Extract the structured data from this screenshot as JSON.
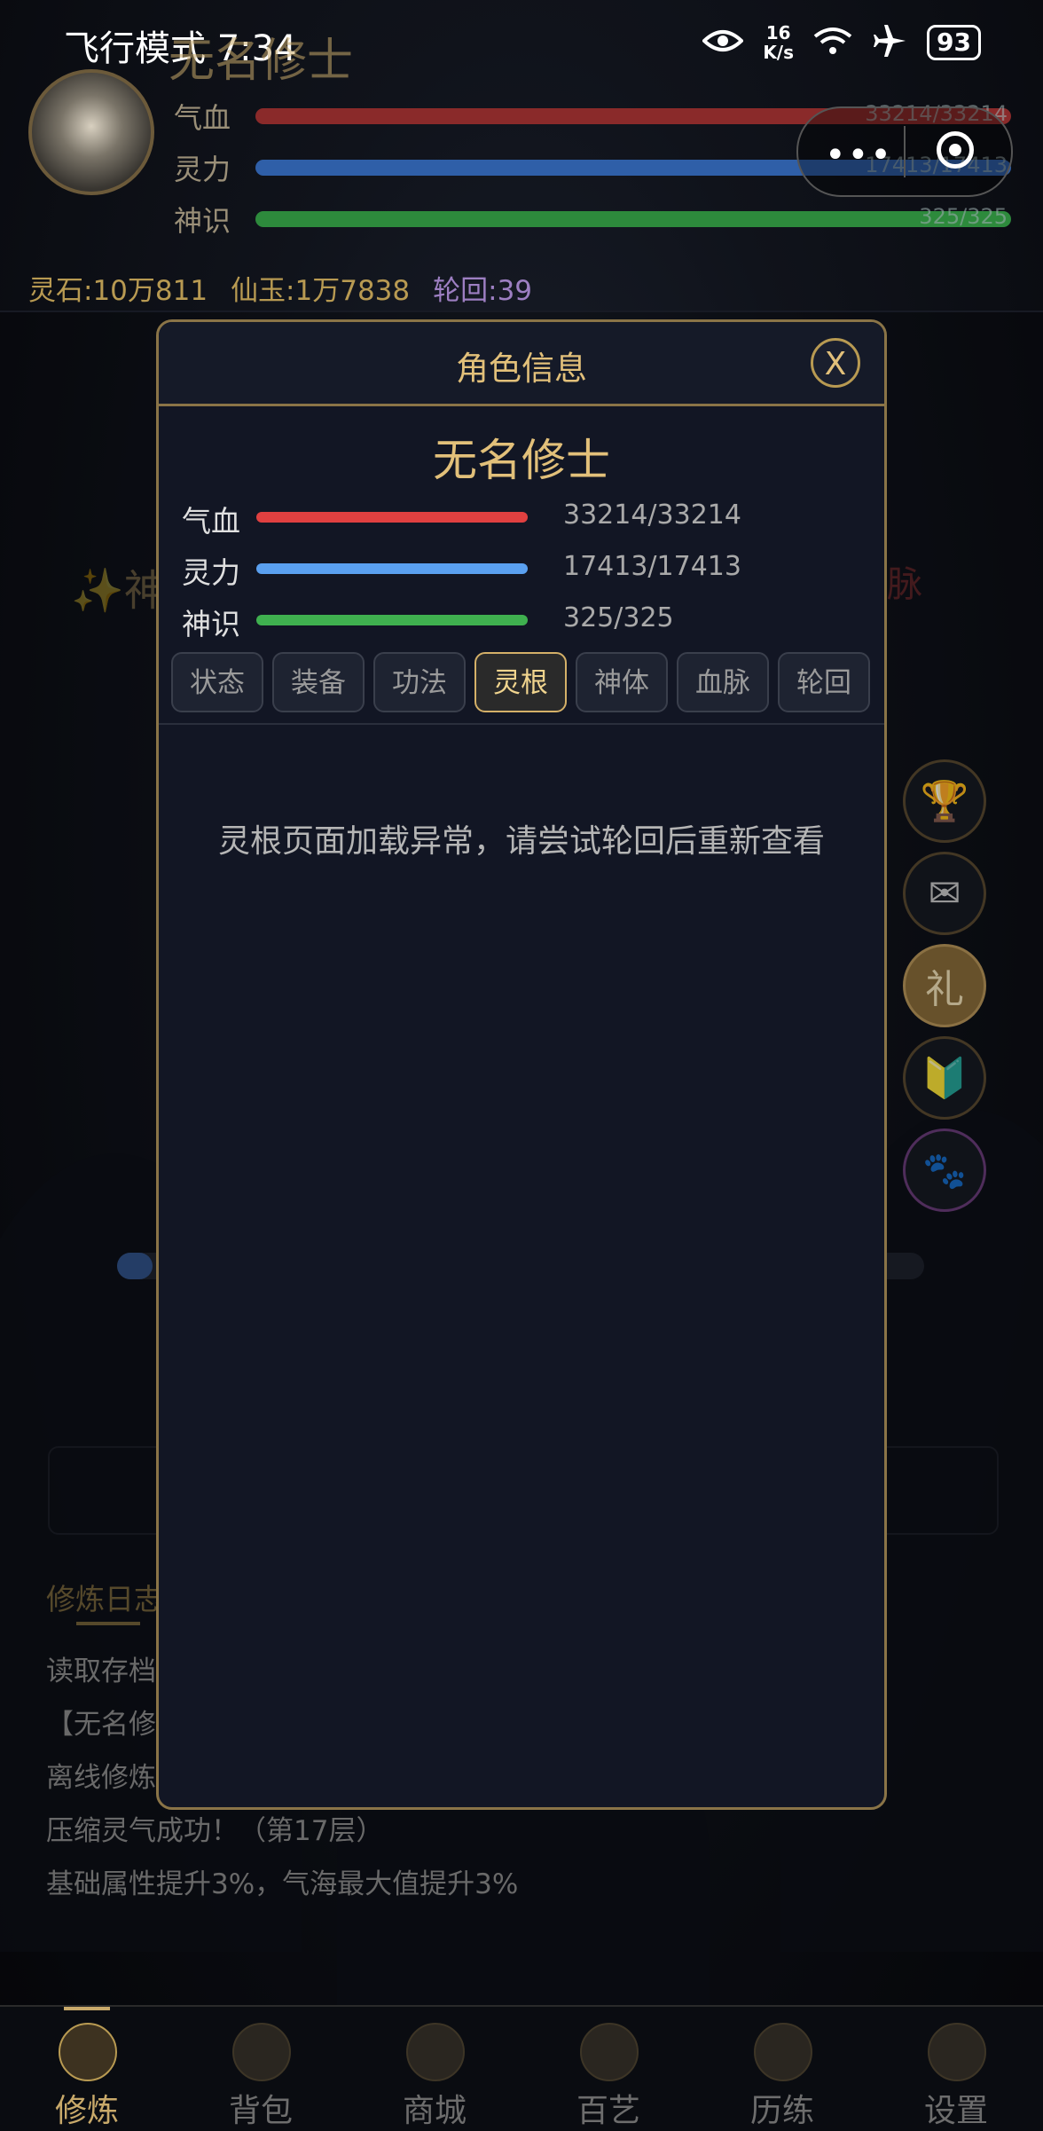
{
  "status_bar": {
    "time": "飞行模式 7:34",
    "net_speed_value": "16",
    "net_speed_unit": "K/s",
    "battery": "93",
    "icons": [
      "eye-icon",
      "wifi-icon",
      "airplane-icon",
      "battery-icon"
    ]
  },
  "header": {
    "name": "无名修士",
    "stats": [
      {
        "label": "气血",
        "value": "33214/33214",
        "color": "#8a2a2a",
        "fraction": 1.0
      },
      {
        "label": "灵力",
        "value": "17413/17413",
        "color": "#2f5fa8",
        "fraction": 1.0
      },
      {
        "label": "神识",
        "value": "325/325",
        "color": "#2d8a3c",
        "fraction": 1.0
      }
    ],
    "currency": {
      "spirit_stone": "灵石:10万811",
      "immortal_jade": "仙玉:1万7838",
      "reincarnation": "轮回:39"
    }
  },
  "background": {
    "skill_text": "✨神",
    "bloodline_text": "血脉",
    "log_title": "修炼日志",
    "log_lines": [
      "读取存档",
      "【无名修",
      "离线修炼",
      "压缩灵气成功！（第17层）",
      "基础属性提升3%，气海最大值提升3%"
    ]
  },
  "side_buttons": [
    {
      "name": "trophy-icon",
      "glyph": "🏆"
    },
    {
      "name": "mail-icon",
      "glyph": "✉"
    },
    {
      "name": "gift-button",
      "glyph": "礼"
    },
    {
      "name": "beginner-icon",
      "glyph": "🔰"
    },
    {
      "name": "paw-icon",
      "glyph": "🐾"
    }
  ],
  "modal": {
    "title": "角色信息",
    "close_label": "X",
    "character_name": "无名修士",
    "stats": [
      {
        "label": "气血",
        "value": "33214/33214",
        "color": "#e04040",
        "fraction": 1.0
      },
      {
        "label": "灵力",
        "value": "17413/17413",
        "color": "#5aa0f0",
        "fraction": 1.0
      },
      {
        "label": "神识",
        "value": "325/325",
        "color": "#3fb04f",
        "fraction": 1.0
      }
    ],
    "tabs": [
      {
        "label": "状态",
        "active": false
      },
      {
        "label": "装备",
        "active": false
      },
      {
        "label": "功法",
        "active": false
      },
      {
        "label": "灵根",
        "active": true
      },
      {
        "label": "神体",
        "active": false
      },
      {
        "label": "血脉",
        "active": false
      },
      {
        "label": "轮回",
        "active": false
      }
    ],
    "message": "灵根页面加载异常，请尝试轮回后重新查看"
  },
  "tabbar": {
    "items": [
      {
        "label": "修炼",
        "active": true
      },
      {
        "label": "背包",
        "active": false
      },
      {
        "label": "商城",
        "active": false
      },
      {
        "label": "百艺",
        "active": false
      },
      {
        "label": "历练",
        "active": false
      },
      {
        "label": "设置",
        "active": false
      }
    ]
  }
}
